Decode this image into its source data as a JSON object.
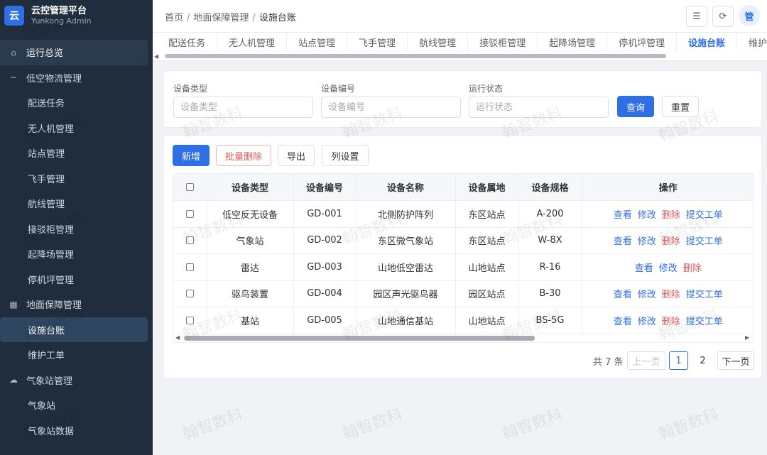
{
  "brand": {
    "logo": "云",
    "title": "云控管理平台",
    "subtitle": "Yunkong Admin"
  },
  "sidebar": {
    "items": [
      {
        "type": "group",
        "label": "运行总览",
        "icon": "home-icon",
        "glyph": "⌂",
        "active": true
      },
      {
        "type": "group",
        "label": "低空物流管理",
        "icon": "collapse-icon",
        "glyph": "~"
      },
      {
        "type": "item",
        "label": "配送任务"
      },
      {
        "type": "item",
        "label": "无人机管理"
      },
      {
        "type": "item",
        "label": "站点管理"
      },
      {
        "type": "item",
        "label": "飞手管理"
      },
      {
        "type": "item",
        "label": "航线管理"
      },
      {
        "type": "item",
        "label": "接驳柜管理"
      },
      {
        "type": "item",
        "label": "起降场管理"
      },
      {
        "type": "item",
        "label": "停机坪管理"
      },
      {
        "type": "group",
        "label": "地面保障管理",
        "icon": "grid-icon",
        "glyph": "▦"
      },
      {
        "type": "item",
        "label": "设施台账",
        "active": true
      },
      {
        "type": "item",
        "label": "维护工单"
      },
      {
        "type": "group",
        "label": "气象站管理",
        "icon": "cloud-icon",
        "glyph": "☁"
      },
      {
        "type": "item",
        "label": "气象站"
      },
      {
        "type": "item",
        "label": "气象站数据"
      }
    ]
  },
  "header": {
    "breadcrumb": [
      "首页",
      "地面保障管理",
      "设施台账"
    ],
    "menu_glyph": "☰",
    "refresh_glyph": "⟳",
    "avatar": "管"
  },
  "tabs": [
    "配送任务",
    "无人机管理",
    "站点管理",
    "飞手管理",
    "航线管理",
    "接驳柜管理",
    "起降场管理",
    "停机坪管理",
    "设施台账",
    "维护工单"
  ],
  "active_tab": "设施台账",
  "filter": {
    "fields": [
      {
        "label": "设备类型",
        "placeholder": "设备类型"
      },
      {
        "label": "设备编号",
        "placeholder": "设备编号"
      },
      {
        "label": "运行状态",
        "placeholder": "运行状态"
      }
    ],
    "query_label": "查询",
    "reset_label": "重置"
  },
  "toolbar": {
    "add": "新增",
    "batch_delete": "批量删除",
    "export": "导出",
    "columns": "列设置"
  },
  "table": {
    "columns": [
      "设备类型",
      "设备编号",
      "设备名称",
      "设备属地",
      "设备规格",
      "操作"
    ],
    "rows": [
      {
        "type": "低空反无设备",
        "code": "GD-001",
        "name": "北侧防护阵列",
        "location": "东区站点",
        "spec": "A-200",
        "actions": [
          "查看",
          "修改",
          "删除",
          "提交工单"
        ]
      },
      {
        "type": "气象站",
        "code": "GD-002",
        "name": "东区微气象站",
        "location": "东区站点",
        "spec": "W-8X",
        "actions": [
          "查看",
          "修改",
          "删除",
          "提交工单"
        ]
      },
      {
        "type": "雷达",
        "code": "GD-003",
        "name": "山地低空雷达",
        "location": "山地站点",
        "spec": "R-16",
        "actions": [
          "查看",
          "修改",
          "删除"
        ]
      },
      {
        "type": "驱鸟装置",
        "code": "GD-004",
        "name": "园区声光驱鸟器",
        "location": "园区站点",
        "spec": "B-30",
        "actions": [
          "查看",
          "修改",
          "删除",
          "提交工单"
        ]
      },
      {
        "type": "基站",
        "code": "GD-005",
        "name": "山地通信基站",
        "location": "山地站点",
        "spec": "BS-5G",
        "actions": [
          "查看",
          "修改",
          "删除",
          "提交工单"
        ]
      }
    ]
  },
  "pagination": {
    "total_text": "共 7 条",
    "prev": "上一页",
    "pages": [
      "1",
      "2"
    ],
    "current": "1",
    "next": "下一页"
  },
  "watermark": "翰智数科",
  "colors": {
    "primary": "#2f6fe6",
    "danger": "#e25b5b",
    "sidebar_bg": "#1f2d3d"
  }
}
